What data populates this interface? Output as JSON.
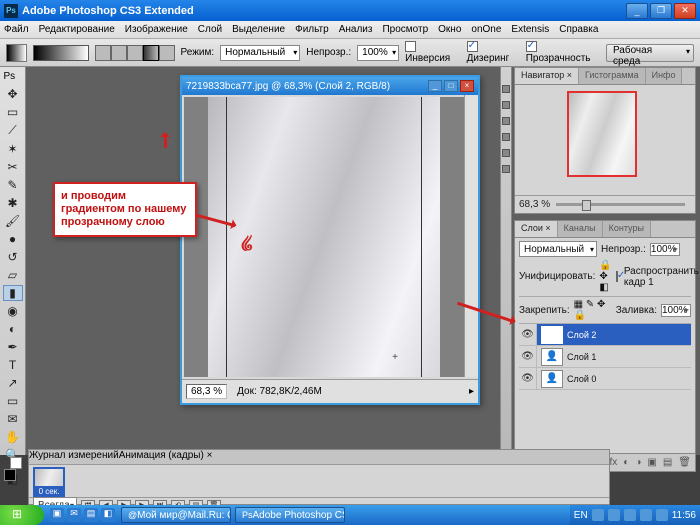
{
  "titlebar": {
    "title": "Adobe Photoshop CS3 Extended"
  },
  "menu": [
    "Файл",
    "Редактирование",
    "Изображение",
    "Слой",
    "Выделение",
    "Фильтр",
    "Анализ",
    "Просмотр",
    "Окно",
    "onOne",
    "Extensis",
    "Справка"
  ],
  "options": {
    "mode_label": "Режим:",
    "mode_value": "Нормальный",
    "opacity_label": "Непрозр.:",
    "opacity_value": "100%",
    "reverse": "Инверсия",
    "dither": "Дизеринг",
    "transp": "Прозрачность",
    "workspace": "Рабочая среда"
  },
  "doc": {
    "title": "7219833bca77.jpg @ 68,3% (Слой 2, RGB/8)",
    "zoom": "68,3 %",
    "info": "Док: 782,8K/2,46M"
  },
  "callout": "и проводим градиентом по нашему прозрачному слою",
  "nav": {
    "tabs": [
      "Навигатор ×",
      "Гистограмма",
      "Инфо"
    ],
    "zoom": "68,3 %"
  },
  "layers": {
    "tabs": [
      "Слои ×",
      "Каналы",
      "Контуры"
    ],
    "blend": "Нормальный",
    "opacity_label": "Непрозр.:",
    "opacity": "100%",
    "unify": "Унифицировать:",
    "prop": "Распространить кадр 1",
    "lock": "Закрепить:",
    "fill_label": "Заливка:",
    "fill": "100%",
    "items": [
      {
        "name": "Слой 2",
        "sel": true
      },
      {
        "name": "Слой 1",
        "sel": false
      },
      {
        "name": "Слой 0",
        "sel": false
      }
    ]
  },
  "anim": {
    "tabs": [
      "Журнал измерений",
      "Анимация (кадры) ×"
    ],
    "frame": "0 сек.",
    "loop": "Всегда"
  },
  "taskbar": {
    "tasks": [
      "Мой мир@Mail.Ru: С...",
      "Adobe Photoshop CS..."
    ],
    "lang": "EN",
    "time": "11:56"
  }
}
